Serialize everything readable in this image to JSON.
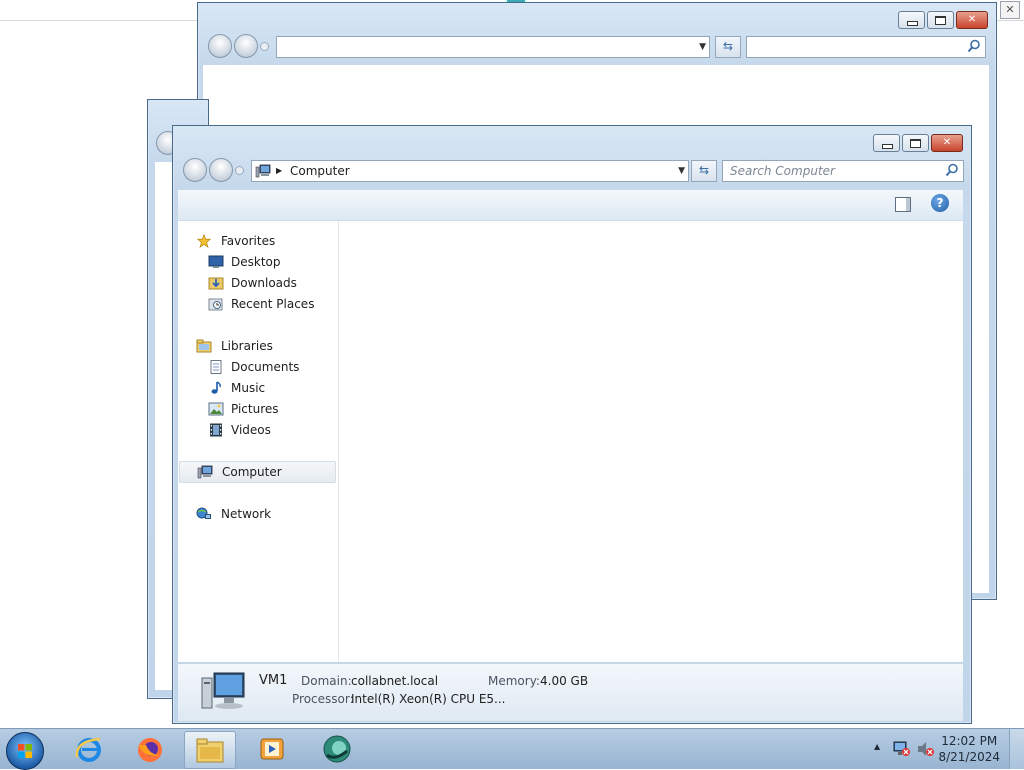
{
  "top_strip": {
    "close_glyph": "✕"
  },
  "windows": {
    "back_window": {
      "minimize": "–",
      "maximize": "□",
      "close": "✕"
    },
    "middle_window": {},
    "main_window": {
      "address": {
        "breadcrumb": "Computer"
      },
      "search": {
        "placeholder": "Search Computer"
      },
      "help_glyph": "?",
      "nav": {
        "favorites": "Favorites",
        "desktop": "Desktop",
        "downloads": "Downloads",
        "recent_places": "Recent Places",
        "libraries": "Libraries",
        "documents": "Documents",
        "music": "Music",
        "pictures": "Pictures",
        "videos": "Videos",
        "computer": "Computer",
        "network": "Network"
      },
      "details": {
        "name": "VM1",
        "domain_label": "Domain:",
        "domain_value": "collabnet.local",
        "memory_label": "Memory:",
        "memory_value": "4.00 GB",
        "processor_label": "Processor:",
        "processor_value": "Intel(R) Xeon(R) CPU E5..."
      }
    }
  },
  "taskbar": {
    "clock_time": "12:02 PM",
    "clock_date": "8/21/2024",
    "tray_arrow": "▲"
  },
  "colors": {
    "accent": "#3b6ea5",
    "close_red": "#c9442c",
    "taskbar": "#a6bfd9"
  }
}
